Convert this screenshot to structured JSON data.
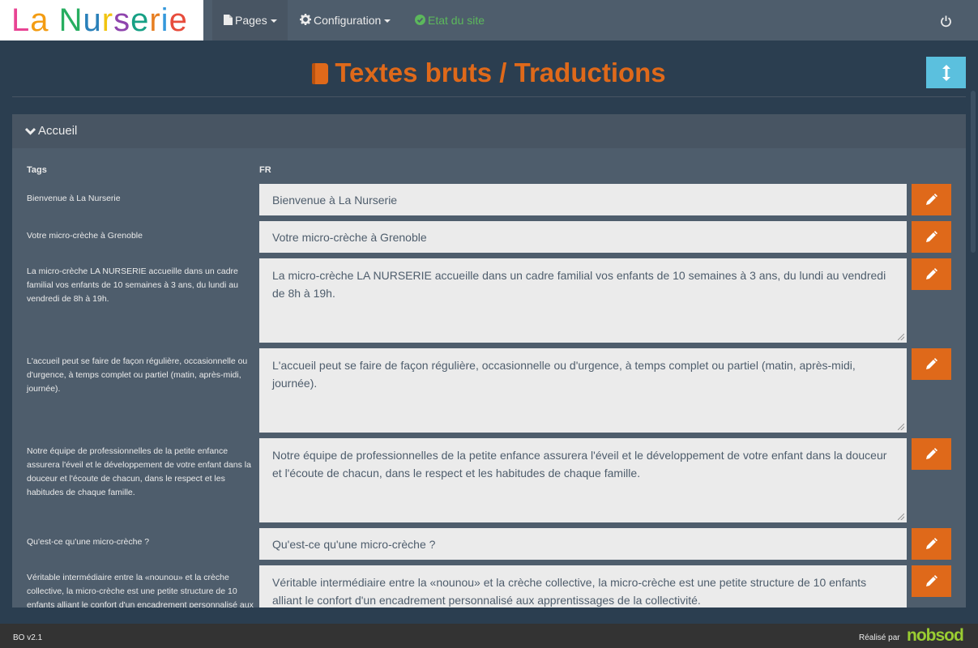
{
  "brand": {
    "logo_letters": [
      "L",
      "a",
      " ",
      "N",
      "u",
      "r",
      "s",
      "e",
      "r",
      "i",
      "e"
    ],
    "logo_colors": [
      "#e84393",
      "#f39c12",
      "#ffffff",
      "#27ae60",
      "#2980b9",
      "#f1c40f",
      "#8e44ad",
      "#16a085",
      "#e67e22",
      "#3498db",
      "#e74c3c"
    ]
  },
  "nav": {
    "pages_label": "Pages",
    "config_label": "Configuration",
    "etat_label": "Etat du site"
  },
  "page": {
    "title": "Textes bruts / Traductions"
  },
  "panel": {
    "heading": "Accueil",
    "col_tags": "Tags",
    "col_fr": "FR",
    "rows": [
      {
        "tag": "Bienvenue à La Nurserie",
        "value": "Bienvenue à La Nurserie",
        "kind": "input"
      },
      {
        "tag": "Votre micro-crèche à Grenoble",
        "value": "Votre micro-crèche à Grenoble",
        "kind": "input"
      },
      {
        "tag": "La micro-crèche LA NURSERIE accueille dans un cadre familial vos enfants de 10 semaines à 3 ans, du lundi au vendredi de 8h à 19h.",
        "value": "La micro-crèche LA NURSERIE accueille dans un cadre familial vos enfants de 10 semaines à 3 ans, du lundi au vendredi de 8h à 19h.",
        "kind": "textarea"
      },
      {
        "tag": "L'accueil peut se faire de façon régulière, occasionnelle ou d'urgence, à temps complet ou partiel (matin, après-midi, journée).",
        "value": "L'accueil peut se faire de façon régulière, occasionnelle ou d'urgence, à temps complet ou partiel (matin, après-midi, journée).",
        "kind": "textarea"
      },
      {
        "tag": "Notre équipe de professionnelles de la petite enfance assurera l'éveil et le développement de votre enfant dans la douceur et l'écoute de chacun, dans le respect et les habitudes de chaque famille.",
        "value": "Notre équipe de professionnelles de la petite enfance assurera l'éveil et le développement de votre enfant dans la douceur et l'écoute de chacun, dans le respect et les habitudes de chaque famille.",
        "kind": "textarea"
      },
      {
        "tag": "Qu'est-ce qu'une micro-crèche ?",
        "value": "Qu'est-ce qu'une micro-crèche ?",
        "kind": "input"
      },
      {
        "tag": "Véritable intermédiaire entre la «nounou» et la crèche collective, la micro-crèche est une petite structure de 10 enfants alliant le confort d'un encadrement personnalisé aux apprentissages de la collectivité.",
        "value": "Véritable intermédiaire entre la «nounou» et la crèche collective, la micro-crèche est une petite structure de 10 enfants alliant le confort d'un encadrement personnalisé aux apprentissages de la collectivité.",
        "kind": "textarea"
      }
    ]
  },
  "footer": {
    "version": "BO v2.1",
    "credit": "Réalisé par",
    "brand": "nobsod"
  },
  "colors": {
    "accent": "#df691a",
    "info": "#5bc0de",
    "success": "#5cb85c"
  }
}
